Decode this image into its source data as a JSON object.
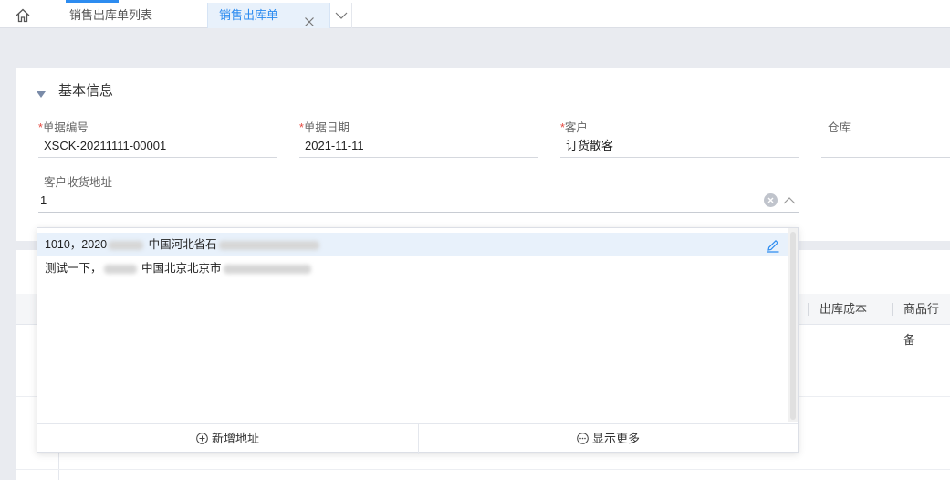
{
  "tabs": {
    "list_tab": "销售出库单列表",
    "active_tab": "销售出库单"
  },
  "section": {
    "title": "基本信息"
  },
  "fields": {
    "doc_no": {
      "label": "单据编号",
      "value": "XSCK-20211111-00001",
      "required": "*"
    },
    "doc_date": {
      "label": "单据日期",
      "value": "2021-11-11",
      "required": "*"
    },
    "customer": {
      "label": "客户",
      "value": "订货散客",
      "required": "*"
    },
    "warehouse": {
      "label": "仓库",
      "value": ""
    },
    "address": {
      "label": "客户收货地址",
      "value": "1"
    }
  },
  "dropdown": {
    "items": [
      {
        "prefix": "1010，2020",
        "text": "中国河北省石"
      },
      {
        "prefix": "测试一下，",
        "text": "中国北京北京市"
      }
    ],
    "add_address": "新增地址",
    "show_more": "显示更多"
  },
  "grid": {
    "columns": [
      "出库成本",
      "商品行备"
    ]
  },
  "colors": {
    "accent": "#2d8cf0",
    "required": "#e5483f",
    "hover_bg": "#e8f1fb"
  }
}
